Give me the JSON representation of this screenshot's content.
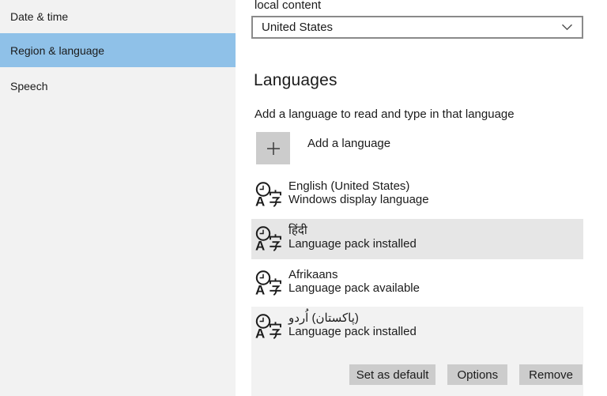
{
  "sidebar": {
    "items": [
      {
        "label": "Date & time"
      },
      {
        "label": "Region & language",
        "selected": true
      },
      {
        "label": "Speech"
      }
    ]
  },
  "country": {
    "description_fragment": "local content",
    "selected": "United States"
  },
  "languages": {
    "heading": "Languages",
    "description": "Add a language to read and type in that language",
    "add_button_label": "Add a language",
    "items": [
      {
        "name": "English (United States)",
        "status": "Windows display language",
        "state": "default"
      },
      {
        "name": "हिंदी",
        "status": "Language pack installed",
        "state": "highlighted"
      },
      {
        "name": "Afrikaans",
        "status": "Language pack available",
        "state": "default"
      },
      {
        "name": "اُردو‎ (پاکستان)",
        "status": "Language pack installed",
        "state": "selected",
        "actions": [
          {
            "label": "Set as default"
          },
          {
            "label": "Options"
          },
          {
            "label": "Remove"
          }
        ]
      }
    ]
  },
  "icons": {
    "language_tile": "language-characters-icon",
    "add": "plus-icon",
    "dropdown": "chevron-down-icon"
  },
  "colors": {
    "sidebar_bg": "#f2f2f2",
    "nav_selected_bg": "#8fc1e8",
    "tile_highlight_bg": "#e6e6e6",
    "tile_selected_bg": "#f2f2f2",
    "button_bg": "#cccccc",
    "dropdown_border": "#8a8a8a",
    "text": "#1b1b1b"
  }
}
